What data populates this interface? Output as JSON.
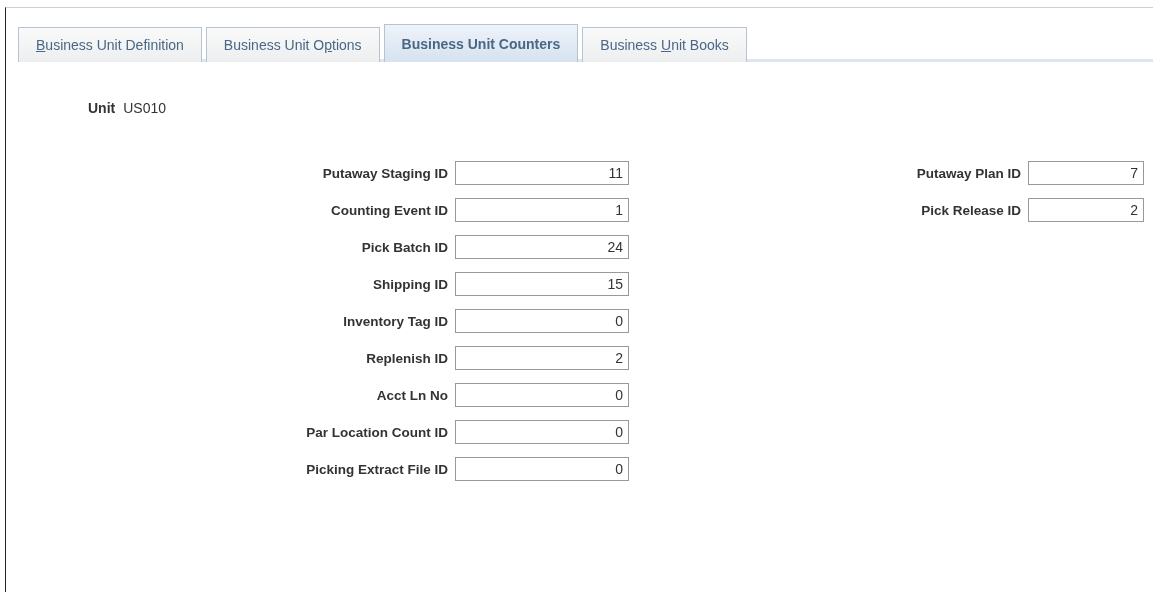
{
  "tabs": [
    {
      "key": "B",
      "after": "usiness Unit Definition",
      "selected": false
    },
    {
      "before": "Business Unit O",
      "key": "p",
      "after": "tions",
      "selected": false
    },
    {
      "before": "Business Unit Counters",
      "selected": true
    },
    {
      "before": "Business ",
      "key": "U",
      "after": "nit Books",
      "selected": false
    }
  ],
  "unit": {
    "label": "Unit",
    "value": "US010"
  },
  "left_fields": [
    {
      "label": "Putaway Staging ID",
      "value": "11"
    },
    {
      "label": "Counting Event ID",
      "value": "1"
    },
    {
      "label": "Pick Batch ID",
      "value": "24"
    },
    {
      "label": "Shipping ID",
      "value": "15"
    },
    {
      "label": "Inventory Tag ID",
      "value": "0"
    },
    {
      "label": "Replenish ID",
      "value": "2"
    },
    {
      "label": "Acct Ln No",
      "value": "0"
    },
    {
      "label": "Par Location Count ID",
      "value": "0"
    },
    {
      "label": "Picking Extract File ID",
      "value": "0"
    }
  ],
  "right_fields": [
    {
      "label": "Putaway Plan ID",
      "value": "7"
    },
    {
      "label": "Pick Release ID",
      "value": "2"
    }
  ]
}
